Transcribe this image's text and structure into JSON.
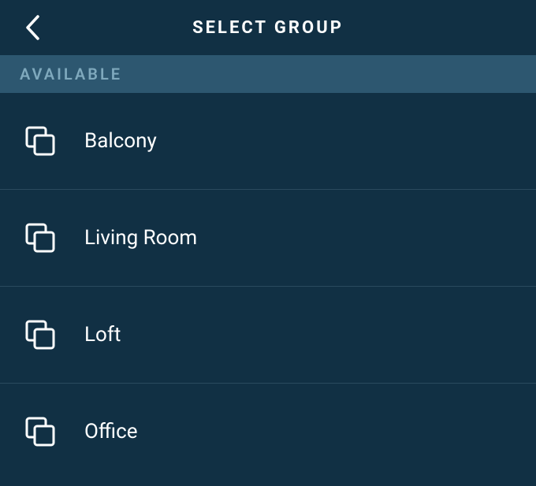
{
  "header": {
    "title": "SELECT GROUP"
  },
  "section": {
    "label": "AVAILABLE"
  },
  "groups": [
    {
      "label": "Balcony"
    },
    {
      "label": "Living Room"
    },
    {
      "label": "Loft"
    },
    {
      "label": "Office"
    }
  ]
}
